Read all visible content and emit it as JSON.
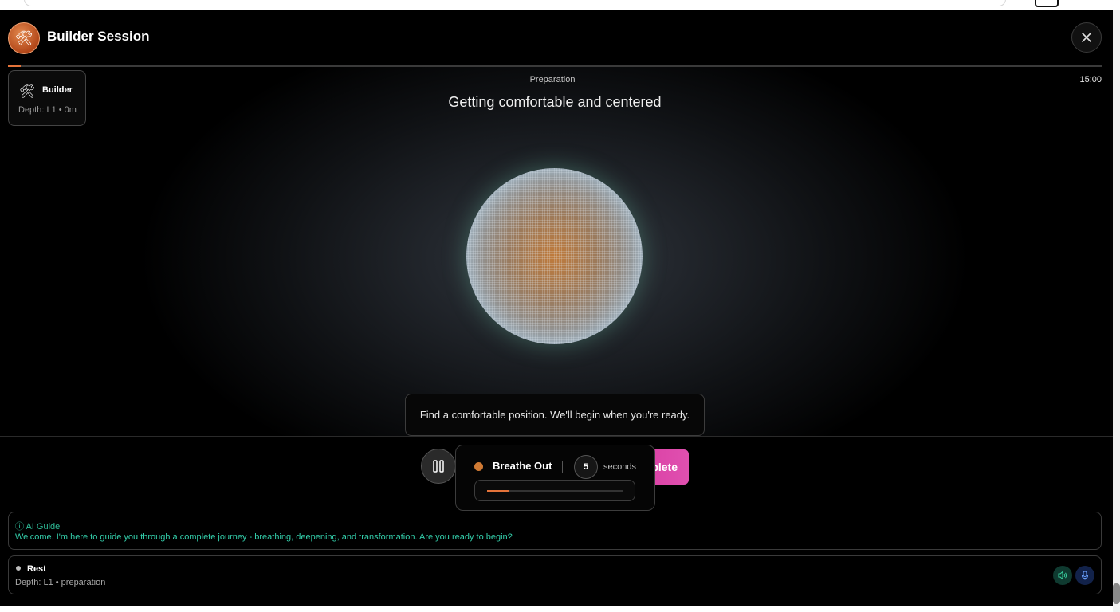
{
  "header": {
    "title": "Builder Session",
    "avatar_icon": "tools-icon"
  },
  "session": {
    "progress_fraction": 0.01
  },
  "persona": {
    "icon": "🛠",
    "name": "Builder",
    "depth": "Depth: L1 • 0m"
  },
  "phase": {
    "label": "Preparation",
    "description": "Getting comfortable and centered",
    "timer": "15:00"
  },
  "hint": {
    "text": "Find a comfortable position. We'll begin when you're ready."
  },
  "controls": {
    "complete_label": "plete"
  },
  "breathing": {
    "state": "Breathe Out",
    "count": "5",
    "unit": "seconds",
    "progress_fraction": 0.16,
    "color": "#d07a34"
  },
  "guide": {
    "header": "ⓘ AI Guide",
    "text": "Welcome. I'm here to guide you through a complete journey - breathing, deepening, and transformation. Are you ready to begin?"
  },
  "status": {
    "state": "Rest",
    "depth": "Depth: L1 • preparation"
  },
  "colors": {
    "accent_orange": "#e4733a",
    "complete_pink": "#d83aa0",
    "guide_teal": "#33d0ac"
  }
}
